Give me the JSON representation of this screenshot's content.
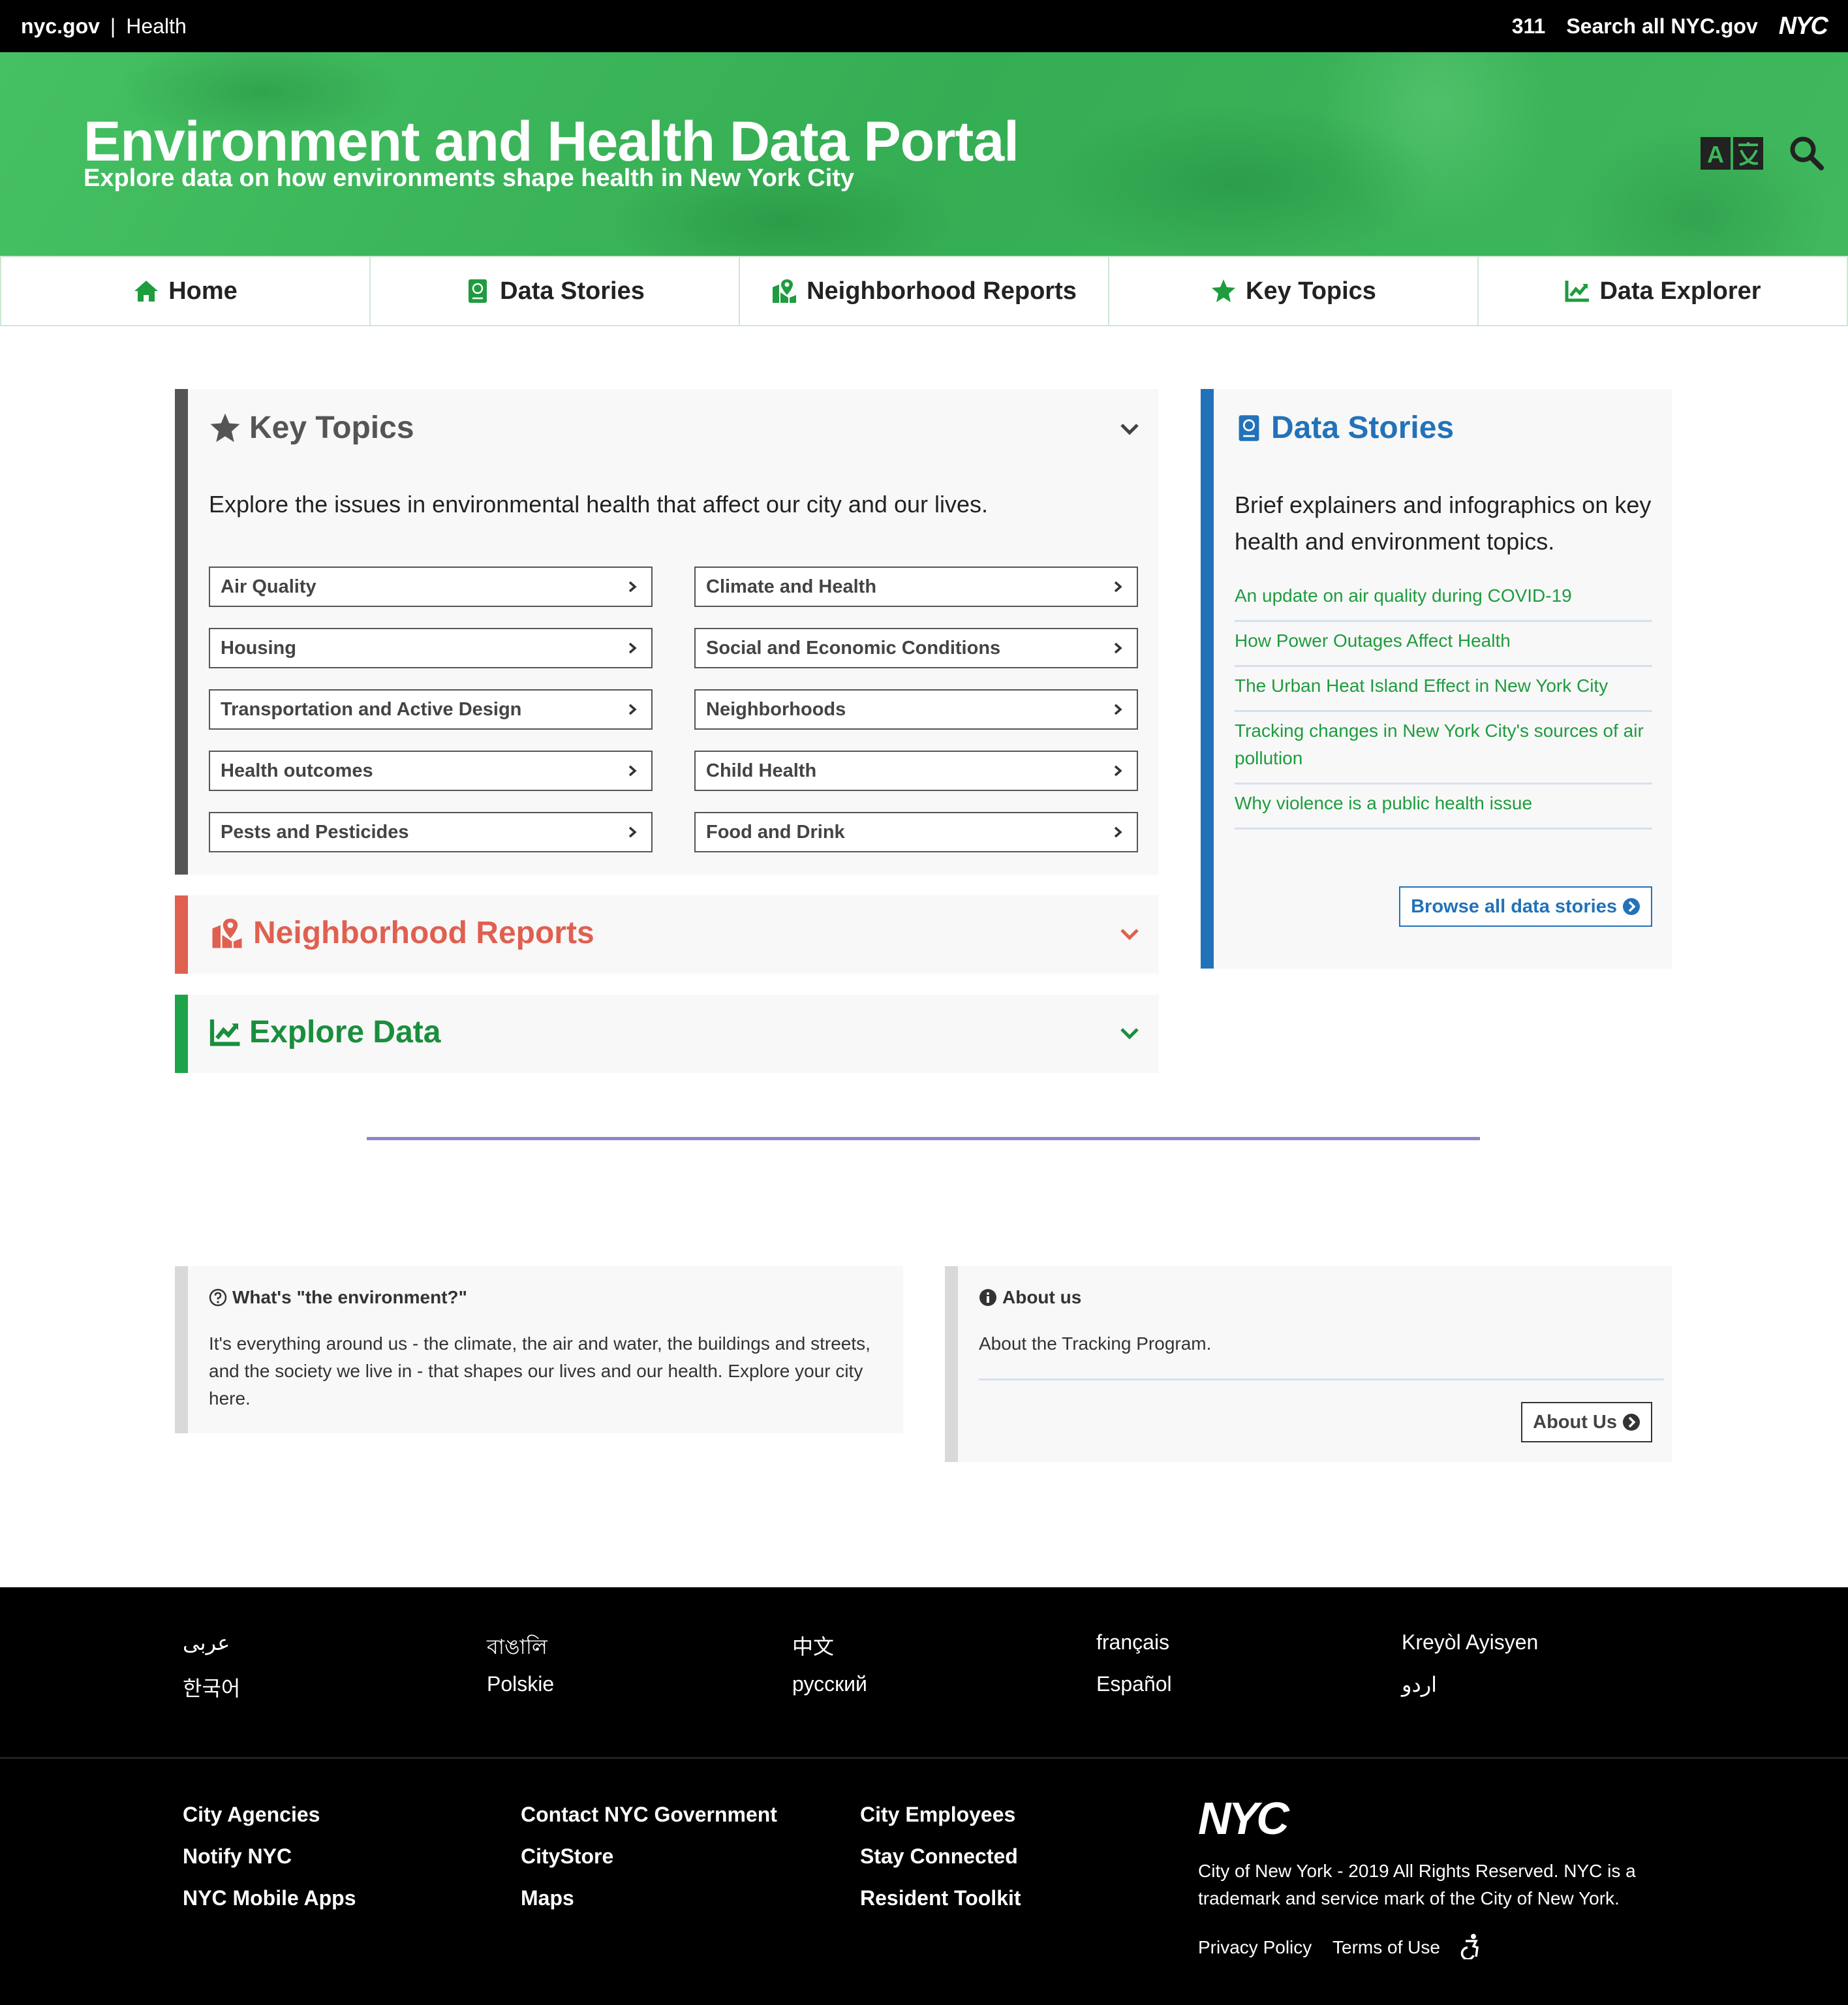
{
  "topbar": {
    "site": "nyc.gov",
    "separator": "|",
    "section": "Health",
    "link_311": "311",
    "search_all": "Search all NYC.gov",
    "logo_text": "NYC"
  },
  "banner": {
    "title": "Environment and Health Data Portal",
    "subtitle": "Explore data on how environments shape health in New York City"
  },
  "nav": [
    {
      "label": "Home",
      "icon": "home-icon"
    },
    {
      "label": "Data Stories",
      "icon": "book-icon"
    },
    {
      "label": "Neighborhood Reports",
      "icon": "map-marker-icon"
    },
    {
      "label": "Key Topics",
      "icon": "star-icon"
    },
    {
      "label": "Data Explorer",
      "icon": "chart-line-icon"
    }
  ],
  "key_topics": {
    "title": "Key Topics",
    "intro": "Explore the issues in environmental health that affect our city and our lives.",
    "left": [
      "Air Quality",
      "Housing",
      "Transportation and Active Design",
      "Health outcomes",
      "Pests and Pesticides"
    ],
    "right": [
      "Climate and Health",
      "Social and Economic Conditions",
      "Neighborhoods",
      "Child Health",
      "Food and Drink"
    ]
  },
  "neighborhood_reports": {
    "title": "Neighborhood Reports"
  },
  "explore_data": {
    "title": "Explore Data"
  },
  "data_stories": {
    "title": "Data Stories",
    "intro": "Brief explainers and infographics on key health and environment topics.",
    "links": [
      "An update on air quality during COVID-19",
      "How Power Outages Affect Health",
      "The Urban Heat Island Effect in New York City",
      "Tracking changes in New York City's sources of air pollution",
      "Why violence is a public health issue"
    ],
    "browse": "Browse all data stories"
  },
  "environment": {
    "title": "What's \"the environment?\"",
    "text": "It's everything around us - the climate, the air and water, the buildings and streets, and the society we live in - that shapes our lives and our health. Explore your city here."
  },
  "about": {
    "title": "About us",
    "text": "About the Tracking Program.",
    "button": "About Us"
  },
  "languages": [
    "عربى",
    "বাঙালি",
    "中文",
    "français",
    "Kreyòl Ayisyen",
    "한국어",
    "Polskie",
    "русский",
    "Español",
    "اردو"
  ],
  "footer_links": [
    [
      "City Agencies",
      "Notify NYC",
      "NYC Mobile Apps"
    ],
    [
      "Contact NYC Government",
      "CityStore",
      "Maps"
    ],
    [
      "City Employees",
      "Stay Connected",
      "Resident Toolkit"
    ]
  ],
  "footer": {
    "copyright": "City of New York - 2019 All Rights Reserved. NYC is a trademark and service mark of the City of New York.",
    "privacy": "Privacy Policy",
    "terms": "Terms of Use"
  },
  "colors": {
    "banner_green": "#3cb95b",
    "nav_icon_green": "#1e9c3e",
    "key_topics_bar": "#555555",
    "neighborhood_red": "#e06050",
    "explore_green": "#1ea34a",
    "data_stories_blue": "#2272b9",
    "divider_purple": "#8f86c9"
  }
}
